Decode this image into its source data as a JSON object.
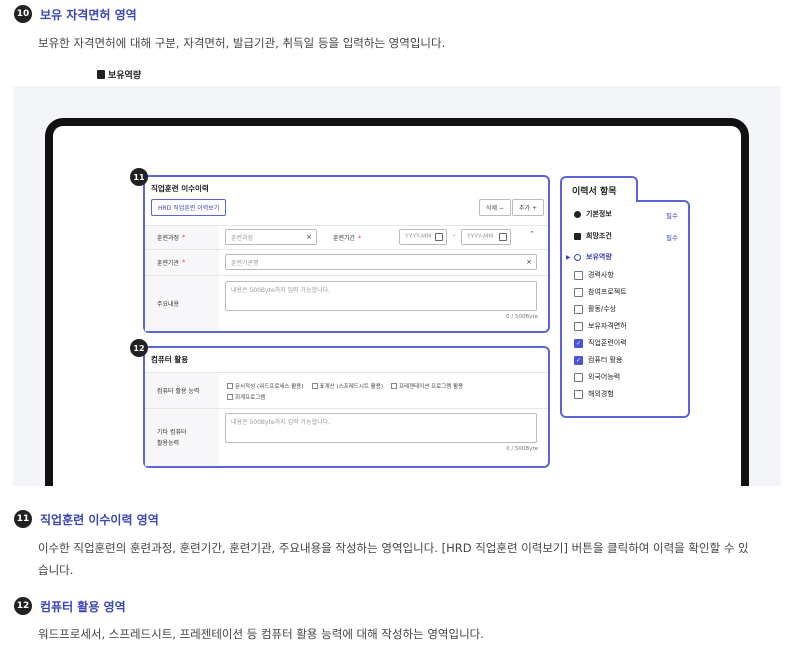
{
  "sections": [
    {
      "num": "10",
      "title": "보유 자격면허 영역",
      "desc": "보유한 자격면허에 대해 구분, 자격면허, 발급기관, 취득일 등을 입력하는 영역입니다."
    },
    {
      "num": "11",
      "title": "직업훈련 이수이력 영역",
      "desc1": "이수한 직업훈련의 훈련과정, 훈련기간, 훈련기관, 주요내용을 작성하는 영역입니다. [HRD 직업훈련 이력보기] 버튼을 클릭하여 이력을 확인할 수 있",
      "desc2": "습니다."
    },
    {
      "num": "12",
      "title": "컴퓨터 활용 영역",
      "desc": "워드프로세서, 스프레드시트, 프레젠테이션 등 컴퓨터 활용 능력에 대해 작성하는 영역입니다."
    }
  ],
  "screen": {
    "page_title": "보유역량",
    "training": {
      "badge": "11",
      "title": "직업훈련 이수이력",
      "hrd_button": "HRD 직업훈련 이력보기",
      "delete_button": "삭제 −",
      "add_button": "추가 +",
      "course_label": "훈련과정",
      "course_placeholder": "훈련과정",
      "period_label": "훈련기간",
      "date_placeholder": "YYYY-MM",
      "date_sep": "-",
      "institution_label": "훈련기관",
      "institution_placeholder": "훈련기관명",
      "content_label": "주요내용",
      "content_placeholder": "내용은 500Byte까지 입력 가능합니다.",
      "counter": "0 / 500Byte"
    },
    "computer": {
      "badge": "12",
      "title": "컴퓨터 활용",
      "ability_label": "컴퓨터 활용 능력",
      "options": [
        "문서작성 (워드프로세스 활용)",
        "표계산 (스프레드시트 활용)",
        "프레젠테이션 프로그램 활용",
        "회계프로그램"
      ],
      "other_label_1": "기타 컴퓨터",
      "other_label_2": "활용능력",
      "other_placeholder": "내용은 500Byte까지 입력 가능합니다.",
      "counter": "0 / 500Byte"
    },
    "sidebar": {
      "title": "이력서 항목",
      "basic": "기본정보",
      "hope": "희망조건",
      "required": "필수",
      "current": "보유역량",
      "items": [
        "경력사항",
        "참여프로젝트",
        "활동/수상",
        "보유자격면허",
        "직업훈련이력",
        "컴퓨터 활용",
        "외국어능력",
        "해외경험"
      ],
      "checked": [
        false,
        false,
        false,
        false,
        true,
        true,
        false,
        false
      ]
    }
  }
}
